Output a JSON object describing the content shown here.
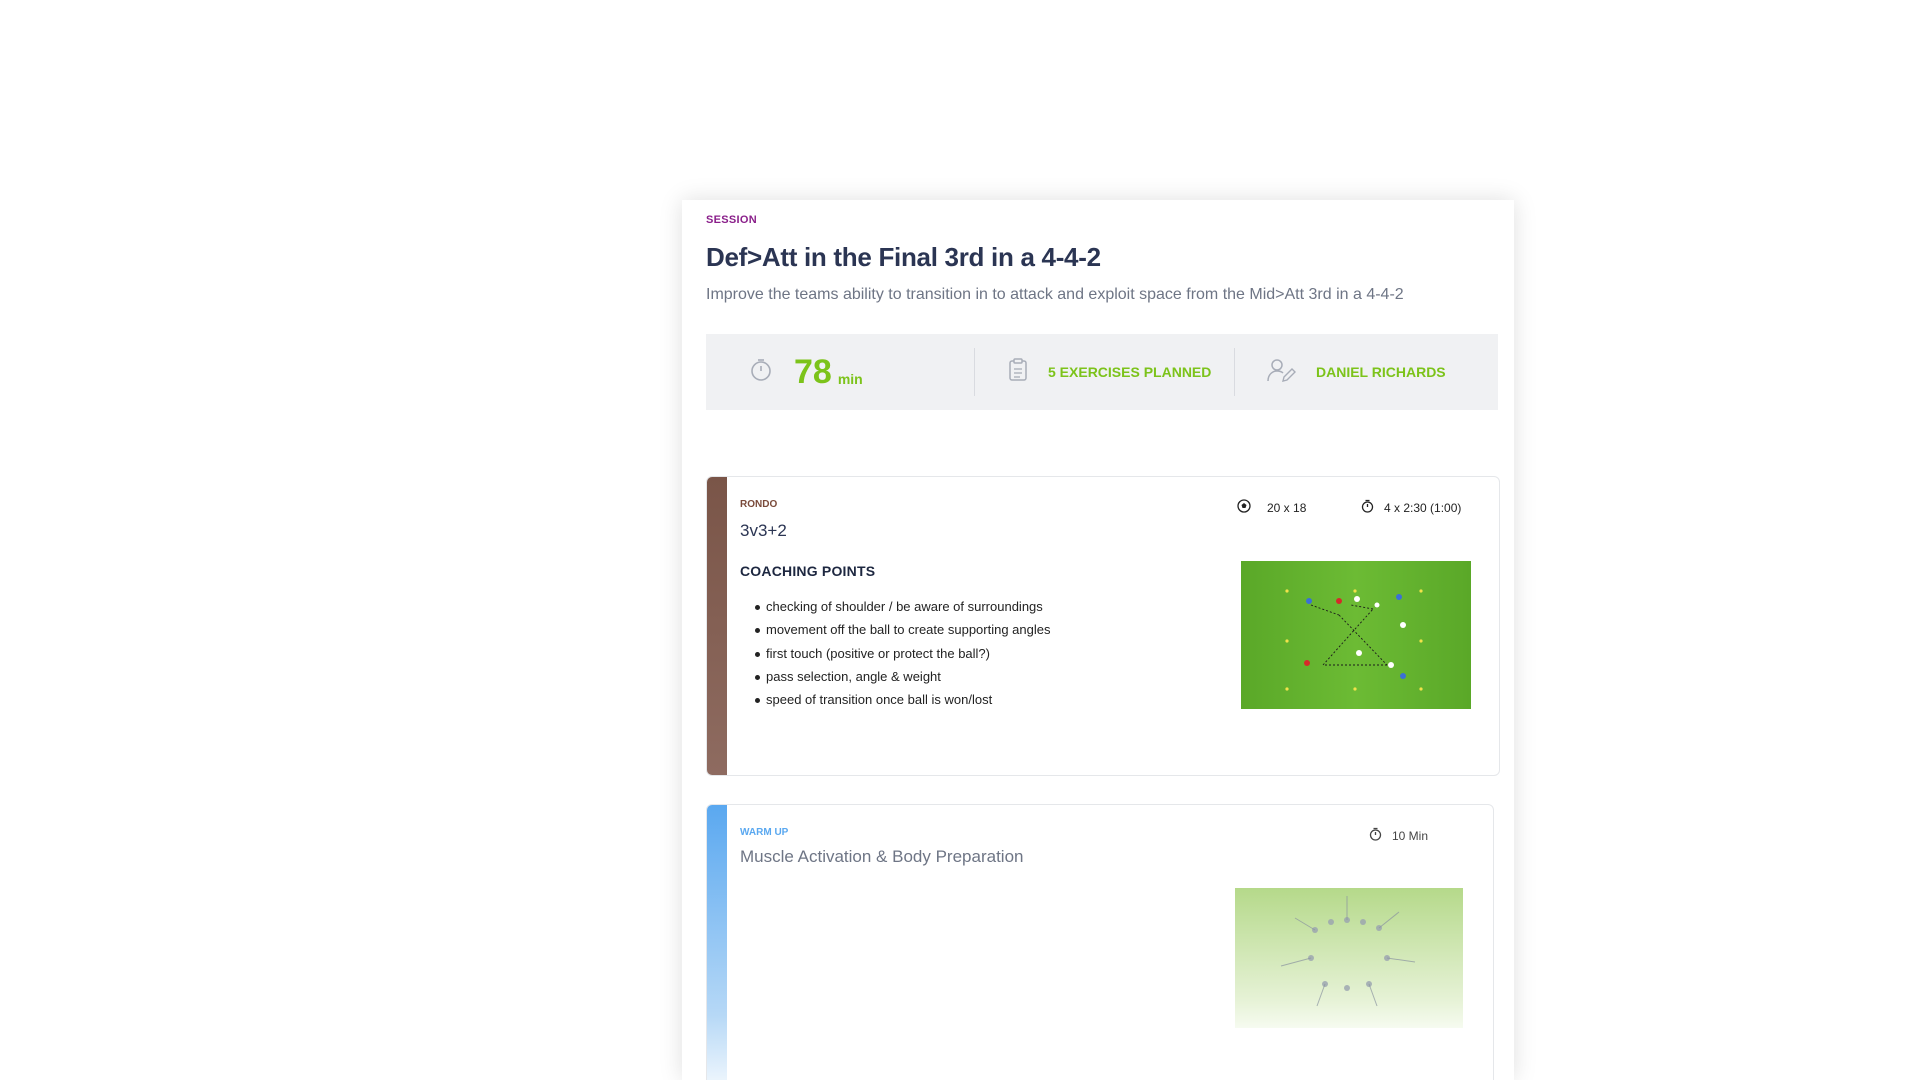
{
  "session": {
    "eyebrow": "SESSION",
    "title": "Def>Att in the Final 3rd in a 4-4-2",
    "description": "Improve the teams ability to transition in to attack and exploit space from the Mid>Att 3rd in a 4-4-2"
  },
  "stats": {
    "duration_value": "78",
    "duration_unit": "min",
    "exercises_label": "5 EXERCISES PLANNED",
    "coach_name": "DANIEL RICHARDS",
    "accent_color": "#7cc31a",
    "icons": [
      "stopwatch-icon",
      "clipboard-icon",
      "user-edit-icon"
    ]
  },
  "exercises": [
    {
      "category": "RONDO",
      "name": "3v3+2",
      "pitch_size": "20 x 18",
      "timing": "4 x 2:30 (1:00)",
      "coaching_title": "COACHING POINTS",
      "coaching_points": [
        "checking of shoulder / be aware of surroundings",
        "movement off the ball to create supporting angles",
        "first touch (positive or protect the ball?)",
        "pass selection, angle & weight",
        "speed of transition once ball is won/lost"
      ],
      "bar_color": "#7a5548"
    },
    {
      "category": "WARM UP",
      "name": "Muscle Activation & Body Preparation",
      "timing": "10 Min",
      "bar_color": "#5aa8f0"
    }
  ]
}
